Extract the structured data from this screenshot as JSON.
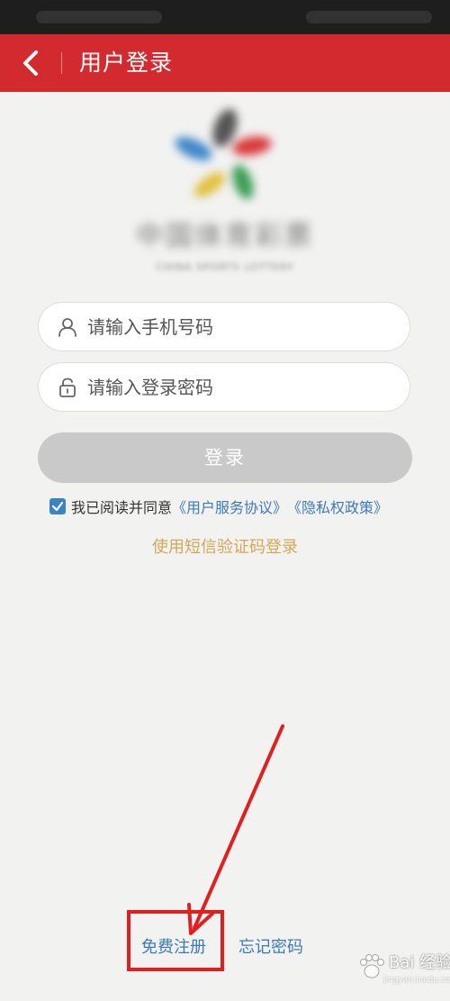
{
  "header": {
    "title": "用户登录",
    "back_icon": "chevron-left-icon",
    "background_color": "#d32a2f"
  },
  "logo": {
    "text_main": "中国体育彩票",
    "text_sub": "CHINA SPORTS LOTTERY"
  },
  "form": {
    "phone_placeholder": "请输入手机号码",
    "phone_icon": "user-icon",
    "password_placeholder": "请输入登录密码",
    "password_icon": "lock-icon",
    "login_label": "登录",
    "login_button_color": "#c9c9c9"
  },
  "agreement": {
    "checked": true,
    "prefix": "我已阅读并同意",
    "service_link": "《用户服务协议》",
    "privacy_link": "《隐私权政策》",
    "link_color": "#3e79b9"
  },
  "sms_login_label": "使用短信验证码登录",
  "sms_login_color": "#d4a758",
  "footer": {
    "register_label": "免费注册",
    "forgot_label": "忘记密码"
  },
  "annotation": {
    "highlight_color": "#e02020"
  },
  "watermark": {
    "text": "Bai 经验",
    "url": "jingyan.baidu.com"
  }
}
